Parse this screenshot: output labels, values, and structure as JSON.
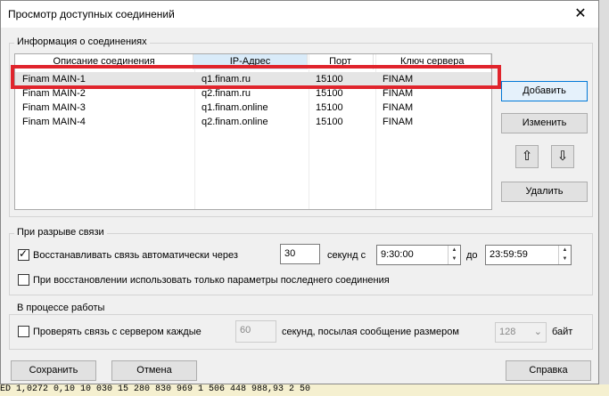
{
  "dialog": {
    "title": "Просмотр доступных соединений",
    "close_glyph": "✕"
  },
  "connections_group": {
    "label": "Информация о соединениях",
    "columns": [
      "Описание соединения",
      "IP-Адрес",
      "Порт",
      "Ключ сервера"
    ],
    "rows": [
      {
        "desc": "Finam MAIN-1",
        "ip": "q1.finam.ru",
        "port": "15100",
        "key": "FINAM"
      },
      {
        "desc": "Finam MAIN-2",
        "ip": "q2.finam.ru",
        "port": "15100",
        "key": "FINAM"
      },
      {
        "desc": "Finam MAIN-3",
        "ip": "q1.finam.online",
        "port": "15100",
        "key": "FINAM"
      },
      {
        "desc": "Finam MAIN-4",
        "ip": "q2.finam.online",
        "port": "15100",
        "key": "FINAM"
      }
    ]
  },
  "buttons": {
    "add": "Добавить",
    "edit": "Изменить",
    "up_glyph": "⇧",
    "down_glyph": "⇩",
    "delete": "Удалить",
    "save": "Сохранить",
    "cancel": "Отмена",
    "help": "Справка"
  },
  "disconnect_group": {
    "label": "При разрыве связи",
    "auto_reconnect_label": "Восстанавливать связь автоматически через",
    "auto_reconnect_checked": true,
    "seconds_value": "30",
    "seconds_from_label": "секунд с",
    "time_from": "9:30:00",
    "to_label": "до",
    "time_to": "23:59:59",
    "last_params_label": "При восстановлении использовать только параметры последнего соединения",
    "last_params_checked": false
  },
  "work_group": {
    "label": "В процессе работы",
    "check_label": "Проверять связь с сервером каждые",
    "check_checked": false,
    "interval_value": "60",
    "mid_label": "секунд, посылая сообщение размером",
    "size_value": "128",
    "unit_label": "байт"
  },
  "background": {
    "strip_text": "ED      1,0272   0,10   10 030     15 280      830        969    1 506 448 988,93        2 50"
  }
}
